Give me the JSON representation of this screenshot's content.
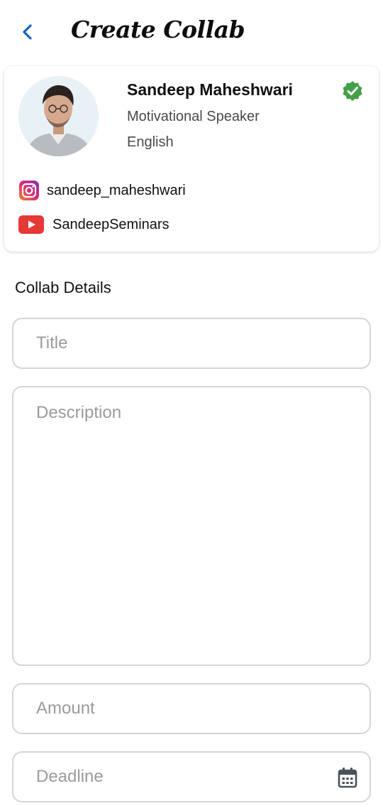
{
  "header": {
    "title": "Create Collab",
    "back_icon": "chevron-left-icon"
  },
  "profile": {
    "name": "Sandeep Maheshwari",
    "role": "Motivational Speaker",
    "language": "English",
    "verified_icon": "verified-badge-icon",
    "socials": [
      {
        "platform": "instagram",
        "handle": "sandeep_maheshwari"
      },
      {
        "platform": "youtube",
        "handle": "SandeepSeminars"
      }
    ]
  },
  "form": {
    "section_title": "Collab Details",
    "title_placeholder": "Title",
    "description_placeholder": "Description",
    "amount_placeholder": "Amount",
    "deadline_placeholder": "Deadline",
    "deadline_icon": "calendar-icon"
  },
  "colors": {
    "accent_blue": "#1565c0",
    "verified_green": "#43a047",
    "instagram": "#d62976",
    "youtube": "#e53935"
  }
}
